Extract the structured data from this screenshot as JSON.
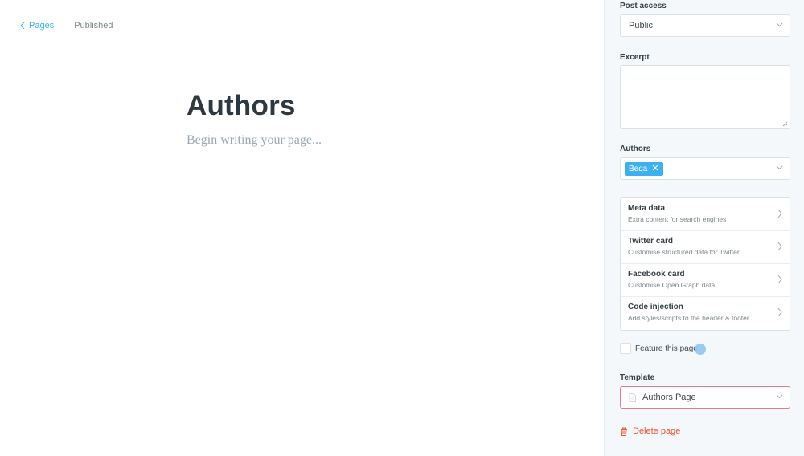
{
  "header": {
    "back_label": "Pages",
    "status": "Published"
  },
  "editor": {
    "title": "Authors",
    "body_placeholder": "Begin writing your page..."
  },
  "settings": {
    "post_access": {
      "label": "Post access",
      "value": "Public"
    },
    "excerpt": {
      "label": "Excerpt",
      "value": ""
    },
    "authors": {
      "label": "Authors",
      "tags": [
        "Beqa"
      ]
    },
    "cards": [
      {
        "title": "Meta data",
        "subtitle": "Extra content for search engines"
      },
      {
        "title": "Twitter card",
        "subtitle": "Customise structured data for Twitter"
      },
      {
        "title": "Facebook card",
        "subtitle": "Customise Open Graph data"
      },
      {
        "title": "Code injection",
        "subtitle": "Add styles/scripts to the header & footer"
      }
    ],
    "feature": {
      "label": "Feature this page",
      "checked": false
    },
    "template": {
      "label": "Template",
      "value": "Authors Page"
    },
    "delete_label": "Delete page"
  },
  "colors": {
    "accent": "#3eb0ef",
    "danger": "#f05230",
    "error_border": "#e47b8b",
    "panel_bg": "#f4f8fb"
  },
  "icons": [
    "chevron-left-icon",
    "chevron-down-icon",
    "chevron-right-icon",
    "close-icon",
    "file-icon",
    "trash-icon",
    "resize-grip-icon"
  ]
}
